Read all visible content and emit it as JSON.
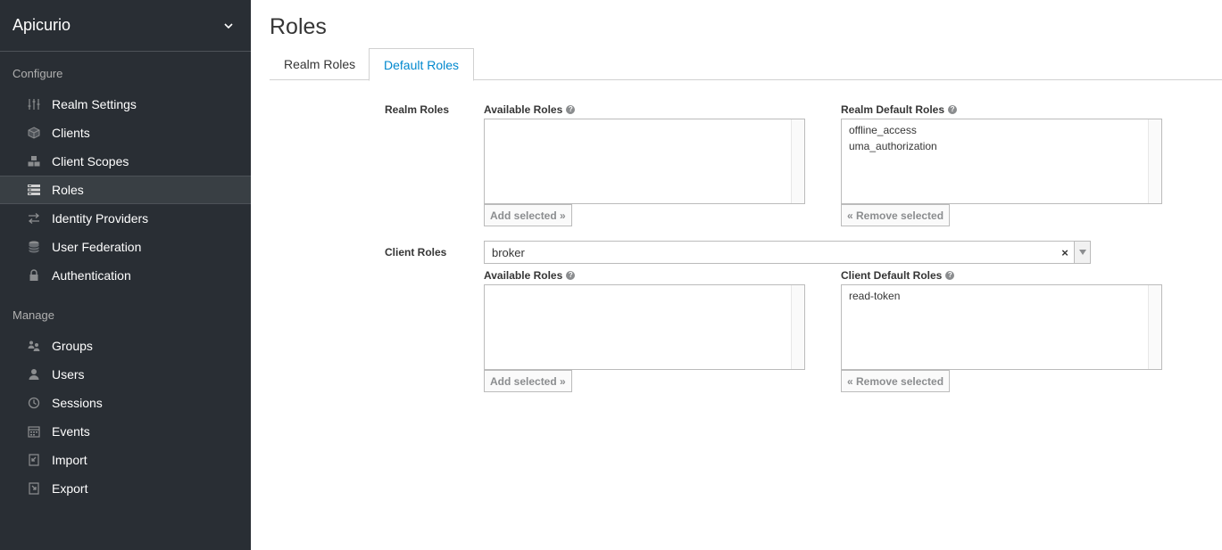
{
  "sidebar": {
    "realm": "Apicurio",
    "configure_title": "Configure",
    "manage_title": "Manage",
    "configure_items": [
      {
        "label": "Realm Settings",
        "icon": "sliders-icon"
      },
      {
        "label": "Clients",
        "icon": "cube-icon"
      },
      {
        "label": "Client Scopes",
        "icon": "cubes-icon"
      },
      {
        "label": "Roles",
        "icon": "roles-icon",
        "active": true
      },
      {
        "label": "Identity Providers",
        "icon": "exchange-icon"
      },
      {
        "label": "User Federation",
        "icon": "database-icon"
      },
      {
        "label": "Authentication",
        "icon": "lock-icon"
      }
    ],
    "manage_items": [
      {
        "label": "Groups",
        "icon": "users-group-icon"
      },
      {
        "label": "Users",
        "icon": "user-icon"
      },
      {
        "label": "Sessions",
        "icon": "clock-icon"
      },
      {
        "label": "Events",
        "icon": "calendar-icon"
      },
      {
        "label": "Import",
        "icon": "import-icon"
      },
      {
        "label": "Export",
        "icon": "export-icon"
      }
    ]
  },
  "main": {
    "title": "Roles",
    "tabs": [
      {
        "label": "Realm Roles"
      },
      {
        "label": "Default Roles",
        "active": true
      }
    ],
    "realm_roles": {
      "section_label": "Realm Roles",
      "available_label": "Available Roles",
      "available_items": [],
      "default_label": "Realm Default Roles",
      "default_items": [
        "offline_access",
        "uma_authorization"
      ],
      "add_button": "Add selected »",
      "remove_button": "« Remove selected"
    },
    "client_roles": {
      "section_label": "Client Roles",
      "selected_client": "broker",
      "clear_symbol": "×",
      "available_label": "Available Roles",
      "available_items": [],
      "default_label": "Client Default Roles",
      "default_items": [
        "read-token"
      ],
      "add_button": "Add selected »",
      "remove_button": "« Remove selected"
    },
    "help_symbol": "?"
  }
}
